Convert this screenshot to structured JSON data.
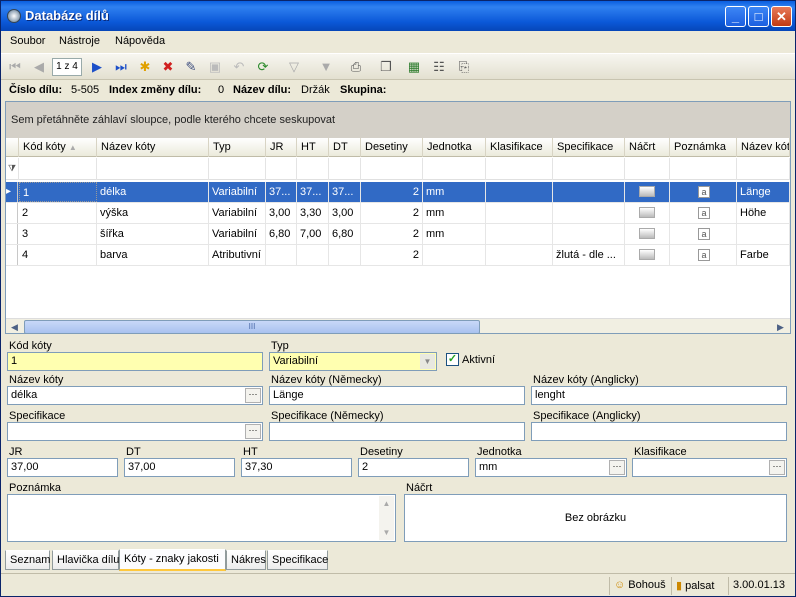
{
  "window": {
    "title": "Databáze dílů"
  },
  "menu": {
    "items": [
      "Soubor",
      "Nástroje",
      "Nápověda"
    ]
  },
  "toolbar": {
    "page_indicator": "1 z 4"
  },
  "info": {
    "part_no_label": "Číslo dílu:",
    "part_no_value": "5-505",
    "change_index_label": "Index změny dílu:",
    "change_index_value": "0",
    "part_name_label": "Název dílu:",
    "part_name_value": "Držák",
    "group_label": "Skupina:"
  },
  "grid": {
    "group_hint": "Sem přetáhněte záhlaví sloupce, podle kterého chcete seskupovat",
    "columns": [
      "Kód kóty",
      "Název kóty",
      "Typ",
      "JR",
      "HT",
      "DT",
      "Desetiny",
      "Jednotka",
      "Klasifikace",
      "Specifikace",
      "Náčrt",
      "Poznámka",
      "Název kóty"
    ],
    "rows": [
      {
        "kod": "1",
        "nazev": "délka",
        "typ": "Variabilní",
        "jr": "37...",
        "ht": "37...",
        "dt": "37...",
        "des": "2",
        "jed": "mm",
        "kla": "",
        "spec": "",
        "nazev_de": "Länge"
      },
      {
        "kod": "2",
        "nazev": "výška",
        "typ": "Variabilní",
        "jr": "3,00",
        "ht": "3,30",
        "dt": "3,00",
        "des": "2",
        "jed": "mm",
        "kla": "",
        "spec": "",
        "nazev_de": "Höhe"
      },
      {
        "kod": "3",
        "nazev": "šířka",
        "typ": "Variabilní",
        "jr": "6,80",
        "ht": "7,00",
        "dt": "6,80",
        "des": "2",
        "jed": "mm",
        "kla": "",
        "spec": "",
        "nazev_de": ""
      },
      {
        "kod": "4",
        "nazev": "barva",
        "typ": "Atributivní",
        "jr": "",
        "ht": "",
        "dt": "",
        "des": "2",
        "jed": "",
        "kla": "",
        "spec": "žlutá - dle ...",
        "nazev_de": "Farbe"
      }
    ],
    "scroll_thumb_glyph": "III"
  },
  "form": {
    "kod_label": "Kód kóty",
    "kod_value": "1",
    "typ_label": "Typ",
    "typ_value": "Variabilní",
    "aktivni_label": "Aktivní",
    "nazev_label": "Název kóty",
    "nazev_value": "délka",
    "nazev_de_label": "Název kóty (Německy)",
    "nazev_de_value": "Länge",
    "nazev_en_label": "Název kóty (Anglicky)",
    "nazev_en_value": "lenght",
    "spec_label": "Specifikace",
    "spec_value": "",
    "spec_de_label": "Specifikace (Německy)",
    "spec_de_value": "",
    "spec_en_label": "Specifikace (Anglicky)",
    "spec_en_value": "",
    "jr_label": "JR",
    "jr_value": "37,00",
    "dt_label": "DT",
    "dt_value": "37,00",
    "ht_label": "HT",
    "ht_value": "37,30",
    "des_label": "Desetiny",
    "des_value": "2",
    "jed_label": "Jednotka",
    "jed_value": "mm",
    "kla_label": "Klasifikace",
    "kla_value": "",
    "poznamka_label": "Poznámka",
    "nacrt_label": "Náčrt",
    "nacrt_empty": "Bez obrázku"
  },
  "tabs": [
    "Seznam",
    "Hlavička dílu",
    "Kóty - znaky jakosti",
    "Nákres",
    "Specifikace"
  ],
  "status": {
    "user": "Bohouš",
    "db": "palsat",
    "version": "3.00.01.13"
  },
  "colors": {
    "selection": "#316ac5",
    "required_field": "#ffffb0",
    "titlebar": "#0a5ee0"
  }
}
